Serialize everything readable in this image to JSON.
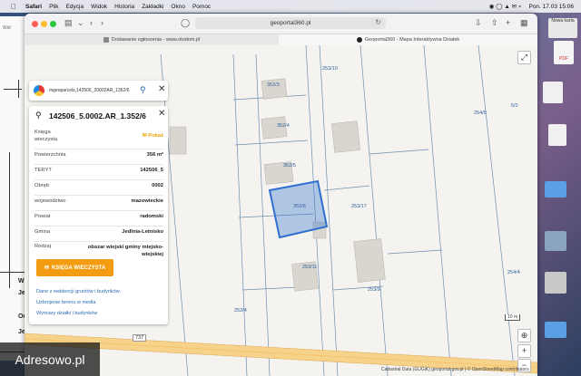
{
  "menubar": {
    "app": "Safari",
    "items": [
      "Plik",
      "Edycja",
      "Widok",
      "Historia",
      "Zakładki",
      "Okno",
      "Pomoc"
    ],
    "clock": "Pon. 17.03  15:06"
  },
  "browser": {
    "url": "geoportal360.pl",
    "tabs": [
      {
        "label": "Dodawanie ogłoszenia - www.otodom.pl"
      },
      {
        "label": "Geoportal360 - Mapa Interaktywna Działek"
      }
    ],
    "new_tab_tooltip": "Nowa karta"
  },
  "search": {
    "query": "mgeoparcels,142506_20002AR_1352/6"
  },
  "parcel": {
    "title": "142506_5.0002.AR_1.352/6",
    "rows": [
      {
        "key": "Księga wieczysta",
        "value": "Pokaż"
      },
      {
        "key": "Powierzchnia",
        "value": "356 m²"
      },
      {
        "key": "TERYT",
        "value": "142506_5"
      },
      {
        "key": "Obręb",
        "value": "0002"
      },
      {
        "key": "województwo",
        "value": "mazowieckie"
      },
      {
        "key": "Powiat",
        "value": "radomski"
      },
      {
        "key": "Gmina",
        "value": "Jedlnia-Letnisko"
      },
      {
        "key": "Rodzaj",
        "value": "obszar wiejski gminy miejsko-wiejskiej"
      }
    ],
    "kw_button": "KSIĘGA WIECZYSTA",
    "links": [
      "Dane z ewidencji gruntów i budynków",
      "Uzbrojenie terenu w media",
      "Wymiary działki i budynków"
    ]
  },
  "map": {
    "labels": [
      "352/3",
      "253/10",
      "352/4",
      "352/5",
      "352/6",
      "253/17",
      "253/11",
      "253/9",
      "254/5",
      "5/2",
      "254/4",
      "252/4",
      "352/3"
    ],
    "scale": "10 m",
    "road_number": "737",
    "attribution": "Cadastral Data (GUGiK) geoportal.gov.pl | © OpenStreetMap contributors",
    "highlight_color": "#2f6fd0"
  },
  "left_doc": {
    "texts": [
      "Wid",
      "Je",
      "Od",
      "Je",
      "W"
    ]
  },
  "desktop": {
    "icons": [
      "PDF"
    ]
  },
  "watermark": "Adresowo.pl"
}
